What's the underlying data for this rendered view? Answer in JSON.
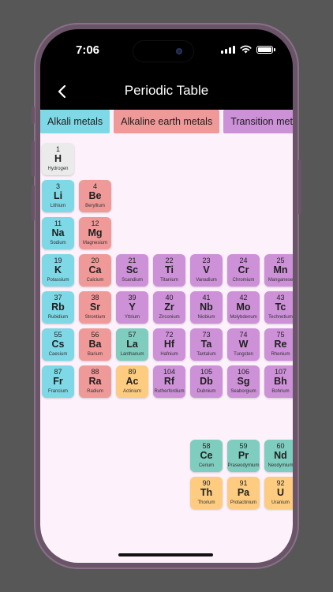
{
  "status": {
    "time": "7:06"
  },
  "app_bar": {
    "title": "Periodic Table"
  },
  "colors": {
    "alkali": "#7fd8e6",
    "alkaline": "#ef9a99",
    "transition": "#cd91d8",
    "lanthanide": "#7fcdbf",
    "actinide": "#fdcc80",
    "hydrogen": "#ebebeb"
  },
  "categories": [
    {
      "label": "Alkali metals",
      "type": "alkali"
    },
    {
      "label": "Alkaline earth metals",
      "type": "alkaline"
    },
    {
      "label": "Transition metals",
      "type": "transition"
    }
  ],
  "elements": [
    {
      "num": "1",
      "sym": "H",
      "name": "Hydrogen",
      "type": "hydrogen",
      "col": 0,
      "row": 0
    },
    {
      "num": "3",
      "sym": "Li",
      "name": "Lithium",
      "type": "alkali",
      "col": 0,
      "row": 1
    },
    {
      "num": "4",
      "sym": "Be",
      "name": "Beryllium",
      "type": "alkaline",
      "col": 1,
      "row": 1
    },
    {
      "num": "11",
      "sym": "Na",
      "name": "Sodium",
      "type": "alkali",
      "col": 0,
      "row": 2
    },
    {
      "num": "12",
      "sym": "Mg",
      "name": "Magnesium",
      "type": "alkaline",
      "col": 1,
      "row": 2
    },
    {
      "num": "19",
      "sym": "K",
      "name": "Potassium",
      "type": "alkali",
      "col": 0,
      "row": 3
    },
    {
      "num": "20",
      "sym": "Ca",
      "name": "Calcium",
      "type": "alkaline",
      "col": 1,
      "row": 3
    },
    {
      "num": "21",
      "sym": "Sc",
      "name": "Scandium",
      "type": "transition",
      "col": 2,
      "row": 3
    },
    {
      "num": "22",
      "sym": "Ti",
      "name": "Titanium",
      "type": "transition",
      "col": 3,
      "row": 3
    },
    {
      "num": "23",
      "sym": "V",
      "name": "Vanadium",
      "type": "transition",
      "col": 4,
      "row": 3
    },
    {
      "num": "24",
      "sym": "Cr",
      "name": "Chromium",
      "type": "transition",
      "col": 5,
      "row": 3
    },
    {
      "num": "25",
      "sym": "Mn",
      "name": "Manganese",
      "type": "transition",
      "col": 6,
      "row": 3
    },
    {
      "num": "37",
      "sym": "Rb",
      "name": "Rubidium",
      "type": "alkali",
      "col": 0,
      "row": 4
    },
    {
      "num": "38",
      "sym": "Sr",
      "name": "Strontium",
      "type": "alkaline",
      "col": 1,
      "row": 4
    },
    {
      "num": "39",
      "sym": "Y",
      "name": "Yttrium",
      "type": "transition",
      "col": 2,
      "row": 4
    },
    {
      "num": "40",
      "sym": "Zr",
      "name": "Zirconium",
      "type": "transition",
      "col": 3,
      "row": 4
    },
    {
      "num": "41",
      "sym": "Nb",
      "name": "Niobium",
      "type": "transition",
      "col": 4,
      "row": 4
    },
    {
      "num": "42",
      "sym": "Mo",
      "name": "Molybdenum",
      "type": "transition",
      "col": 5,
      "row": 4
    },
    {
      "num": "43",
      "sym": "Tc",
      "name": "Technetium",
      "type": "transition",
      "col": 6,
      "row": 4
    },
    {
      "num": "55",
      "sym": "Cs",
      "name": "Caesium",
      "type": "alkali",
      "col": 0,
      "row": 5
    },
    {
      "num": "56",
      "sym": "Ba",
      "name": "Barium",
      "type": "alkaline",
      "col": 1,
      "row": 5
    },
    {
      "num": "57",
      "sym": "La",
      "name": "Lanthanum",
      "type": "lanthanide",
      "col": 2,
      "row": 5
    },
    {
      "num": "72",
      "sym": "Hf",
      "name": "Hafnium",
      "type": "transition",
      "col": 3,
      "row": 5
    },
    {
      "num": "73",
      "sym": "Ta",
      "name": "Tantalum",
      "type": "transition",
      "col": 4,
      "row": 5
    },
    {
      "num": "74",
      "sym": "W",
      "name": "Tungsten",
      "type": "transition",
      "col": 5,
      "row": 5
    },
    {
      "num": "75",
      "sym": "Re",
      "name": "Rhenium",
      "type": "transition",
      "col": 6,
      "row": 5
    },
    {
      "num": "87",
      "sym": "Fr",
      "name": "Francium",
      "type": "alkali",
      "col": 0,
      "row": 6
    },
    {
      "num": "88",
      "sym": "Ra",
      "name": "Radium",
      "type": "alkaline",
      "col": 1,
      "row": 6
    },
    {
      "num": "89",
      "sym": "Ac",
      "name": "Actinium",
      "type": "actinide",
      "col": 2,
      "row": 6
    },
    {
      "num": "104",
      "sym": "Rf",
      "name": "Rutherfordium",
      "type": "transition",
      "col": 3,
      "row": 6
    },
    {
      "num": "105",
      "sym": "Db",
      "name": "Dubnium",
      "type": "transition",
      "col": 4,
      "row": 6
    },
    {
      "num": "106",
      "sym": "Sg",
      "name": "Seaborgium",
      "type": "transition",
      "col": 5,
      "row": 6
    },
    {
      "num": "107",
      "sym": "Bh",
      "name": "Bohrium",
      "type": "transition",
      "col": 6,
      "row": 6
    },
    {
      "num": "58",
      "sym": "Ce",
      "name": "Cerium",
      "type": "lanthanide",
      "col": 4,
      "row": 8
    },
    {
      "num": "59",
      "sym": "Pr",
      "name": "Praseodymium",
      "type": "lanthanide",
      "col": 5,
      "row": 8
    },
    {
      "num": "60",
      "sym": "Nd",
      "name": "Neodymium",
      "type": "lanthanide",
      "col": 6,
      "row": 8
    },
    {
      "num": "90",
      "sym": "Th",
      "name": "Thorium",
      "type": "actinide",
      "col": 4,
      "row": 9
    },
    {
      "num": "91",
      "sym": "Pa",
      "name": "Protactinium",
      "type": "actinide",
      "col": 5,
      "row": 9
    },
    {
      "num": "92",
      "sym": "U",
      "name": "Uranium",
      "type": "actinide",
      "col": 6,
      "row": 9
    }
  ]
}
